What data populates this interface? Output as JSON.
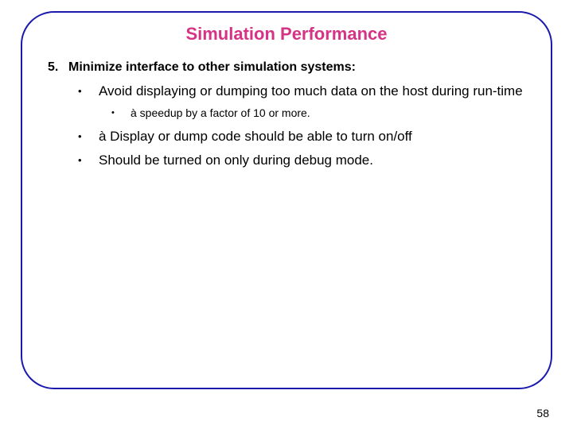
{
  "title": "Simulation Performance",
  "item": {
    "number": "5.",
    "text": "Minimize interface to other simulation systems:"
  },
  "b1": {
    "text": "Avoid displaying or dumping too much data on the host during run-time"
  },
  "b1sub": {
    "text": "à speedup by a factor of 10 or more."
  },
  "b2": {
    "text": "à Display or dump code should be able to turn on/off"
  },
  "b3": {
    "text": "Should be turned on only during debug mode."
  },
  "pageNumber": "58"
}
